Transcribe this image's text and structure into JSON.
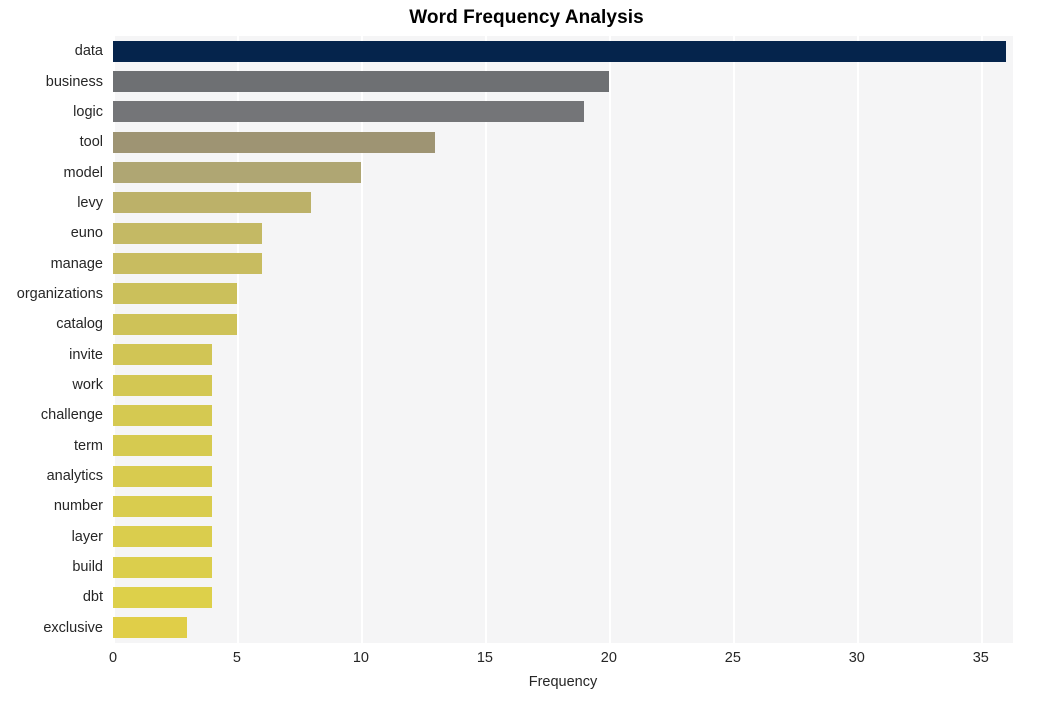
{
  "chart_data": {
    "type": "bar",
    "orientation": "horizontal",
    "title": "Word Frequency Analysis",
    "xlabel": "Frequency",
    "ylabel": "",
    "categories": [
      "data",
      "business",
      "logic",
      "tool",
      "model",
      "levy",
      "euno",
      "manage",
      "organizations",
      "catalog",
      "invite",
      "work",
      "challenge",
      "term",
      "analytics",
      "number",
      "layer",
      "build",
      "dbt",
      "exclusive"
    ],
    "values": [
      36,
      20,
      19,
      13,
      10,
      8,
      6,
      6,
      5,
      5,
      4,
      4,
      4,
      4,
      4,
      4,
      4,
      4,
      4,
      3
    ],
    "bar_colors": [
      "#05244c",
      "#6e7073",
      "#747578",
      "#9e9473",
      "#afa673",
      "#bcb169",
      "#c4b964",
      "#c8bc60",
      "#cbc05b",
      "#cec258",
      "#d1c555",
      "#d3c753",
      "#d5c951",
      "#d6ca50",
      "#d8cb4f",
      "#d9cc4e",
      "#daCD4d",
      "#dbce4c",
      "#ddd04a",
      "#e0ce48"
    ],
    "xlim": [
      0,
      36.3
    ],
    "xticks": [
      0,
      5,
      10,
      15,
      20,
      25,
      30,
      35
    ],
    "xticklabels": [
      "0",
      "5",
      "10",
      "15",
      "20",
      "25",
      "30",
      "35"
    ],
    "grid": true,
    "grid_axis": "x",
    "grid_color": "#ffffff",
    "plot_background": "#f5f5f6",
    "figure_background": "#ffffff",
    "legend": null,
    "colormap": "cividis"
  }
}
